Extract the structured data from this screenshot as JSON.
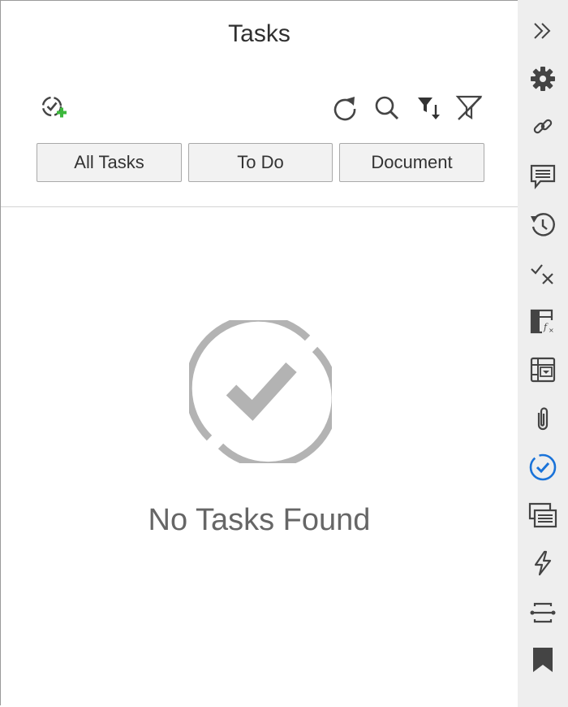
{
  "panel": {
    "title": "Tasks",
    "tabs": [
      {
        "label": "All Tasks"
      },
      {
        "label": "To Do"
      },
      {
        "label": "Document"
      }
    ],
    "empty_message": "No Tasks Found"
  },
  "toolbar": {
    "icons": [
      "add-task-icon",
      "refresh-icon",
      "search-icon",
      "sort-filter-icon",
      "clear-filter-icon"
    ]
  },
  "rail": {
    "icons": [
      "collapse-icon",
      "gear-icon",
      "link-icon",
      "comment-icon",
      "history-icon",
      "approve-reject-icon",
      "formula-icon",
      "table-dropdown-icon",
      "paperclip-icon",
      "tasks-icon",
      "notes-icon",
      "lightning-icon",
      "connector-icon",
      "bookmark-icon"
    ],
    "active": "tasks-icon"
  },
  "colors": {
    "accent_blue": "#1a73d9",
    "add_green": "#3cb83c",
    "icon_gray": "#555555",
    "empty_gray": "#b3b3b3",
    "rail_bg": "#eeeeee"
  }
}
